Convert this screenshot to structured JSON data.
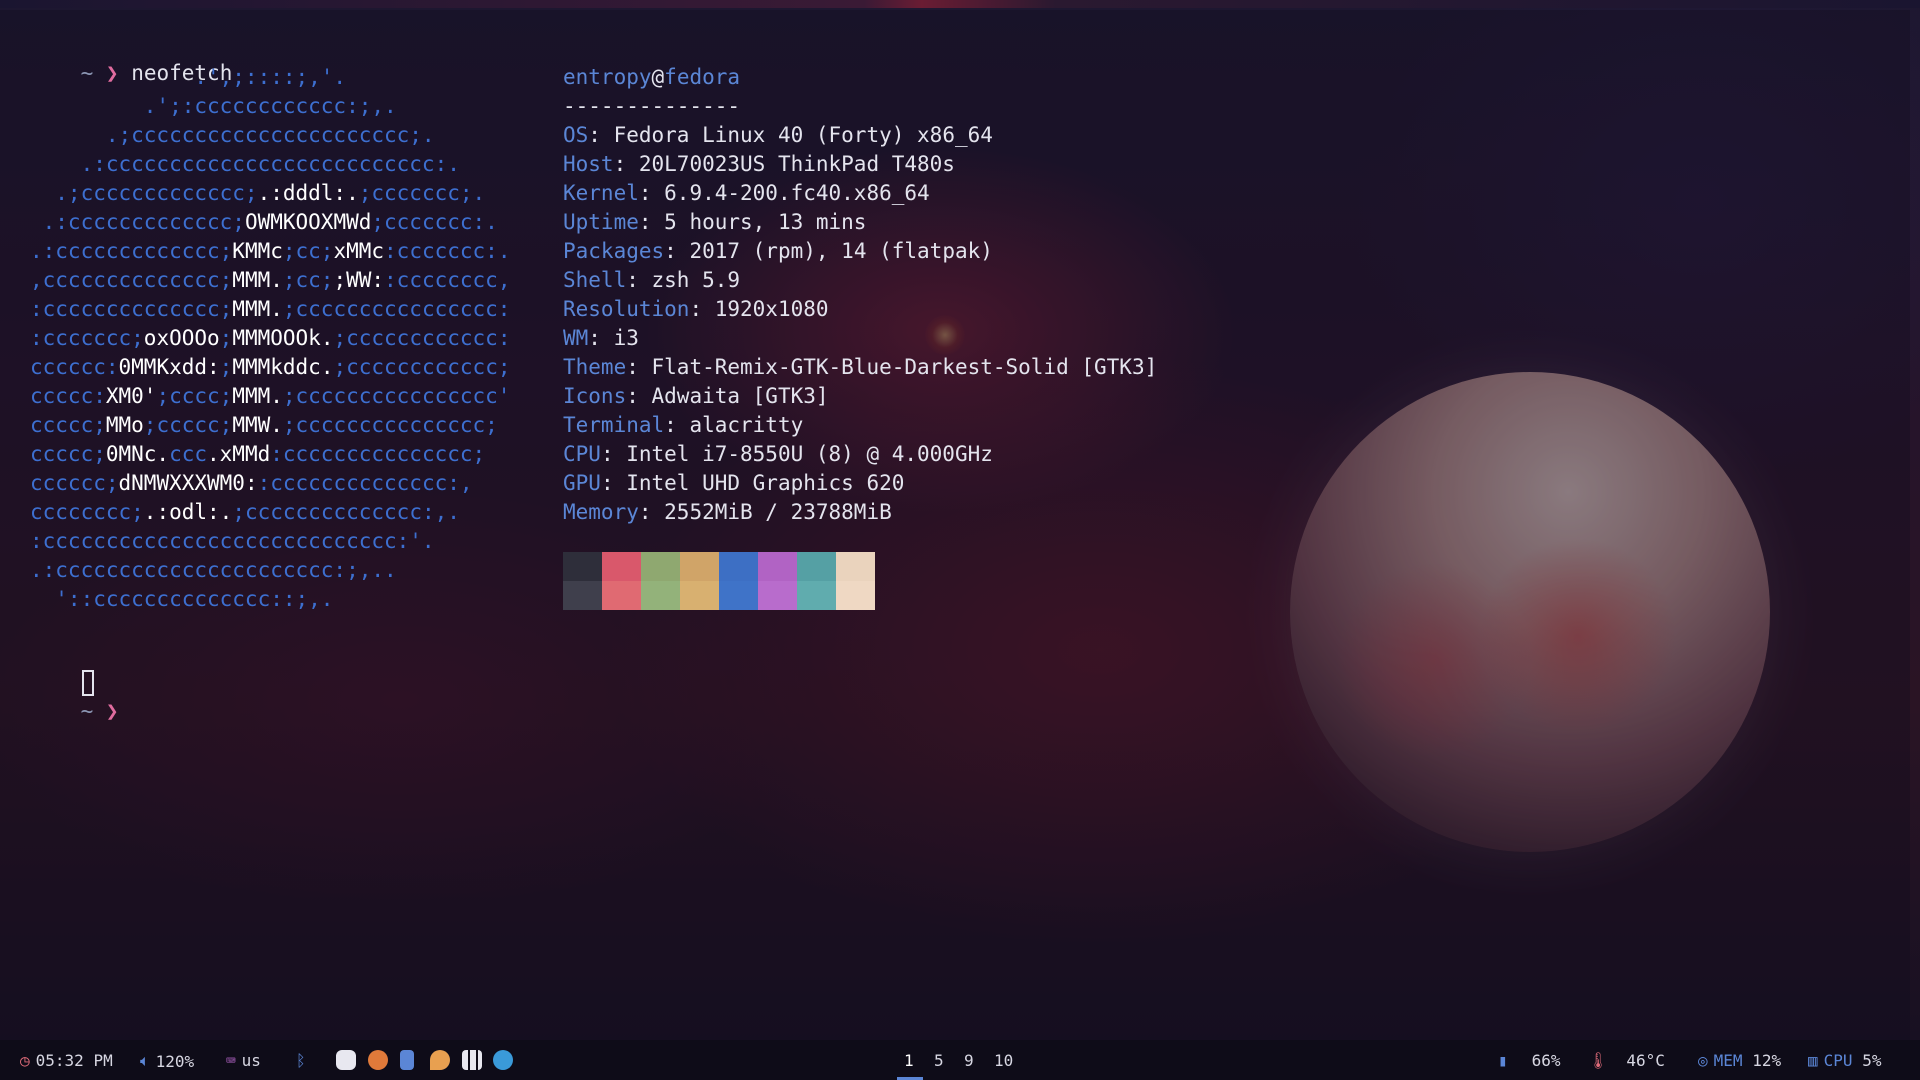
{
  "command_line": {
    "tilde": "~",
    "arrow": "❯",
    "command": "neofetch"
  },
  "ascii_logo": [
    [
      [
        "b",
        "             .',;::::;,'.     "
      ]
    ],
    [
      [
        "b",
        "         .';:cccccccccccc:;,.  "
      ]
    ],
    [
      [
        "b",
        "      .;cccccccccccccccccccccc;."
      ]
    ],
    [
      [
        "b",
        "    .:cccccccccccccccccccccccccc:."
      ]
    ],
    [
      [
        "b",
        "  .;ccccccccccccc;"
      ],
      [
        "w",
        ".:dddl:."
      ],
      [
        "b",
        ";ccccccc;."
      ]
    ],
    [
      [
        "b",
        " .:ccccccccccccc;"
      ],
      [
        "w",
        "OWMKOOXMWd"
      ],
      [
        "b",
        ";ccccccc:."
      ]
    ],
    [
      [
        "b",
        ".:ccccccccccccc;"
      ],
      [
        "w",
        "KMMc"
      ],
      [
        "b",
        ";cc;"
      ],
      [
        "w",
        "xMMc"
      ],
      [
        "b",
        ":ccccccc:."
      ]
    ],
    [
      [
        "b",
        ",cccccccccccccc;"
      ],
      [
        "w",
        "MMM."
      ],
      [
        "b",
        ";cc;"
      ],
      [
        "w",
        ";WW:"
      ],
      [
        "b",
        ":cccccccc,"
      ]
    ],
    [
      [
        "b",
        ":cccccccccccccc;"
      ],
      [
        "w",
        "MMM."
      ],
      [
        "b",
        ";cccccccccccccccc:"
      ]
    ],
    [
      [
        "b",
        ":ccccccc;"
      ],
      [
        "w",
        "oxOOOo"
      ],
      [
        "b",
        ";"
      ],
      [
        "w",
        "MMMOOOk."
      ],
      [
        "b",
        ";cccccccccccc:"
      ]
    ],
    [
      [
        "b",
        "cccccc:"
      ],
      [
        "w",
        "0MMKxdd:"
      ],
      [
        "b",
        ";"
      ],
      [
        "w",
        "MMMkddc."
      ],
      [
        "b",
        ";cccccccccccc;"
      ]
    ],
    [
      [
        "b",
        "ccccc:"
      ],
      [
        "w",
        "XM0'"
      ],
      [
        "b",
        ";cccc;"
      ],
      [
        "w",
        "MMM."
      ],
      [
        "b",
        ";cccccccccccccccc'"
      ]
    ],
    [
      [
        "b",
        "ccccc;"
      ],
      [
        "w",
        "MMo"
      ],
      [
        "b",
        ";ccccc;"
      ],
      [
        "w",
        "MMW."
      ],
      [
        "b",
        ";ccccccccccccccc;"
      ]
    ],
    [
      [
        "b",
        "ccccc;"
      ],
      [
        "w",
        "0MNc."
      ],
      [
        "b",
        "ccc"
      ],
      [
        "w",
        ".xMMd"
      ],
      [
        "b",
        ":ccccccccccccccc;"
      ]
    ],
    [
      [
        "b",
        "cccccc;"
      ],
      [
        "w",
        "dNMWXXXWM0:"
      ],
      [
        "b",
        ":cccccccccccccc:,"
      ]
    ],
    [
      [
        "b",
        "cccccccc;"
      ],
      [
        "w",
        ".:odl:."
      ],
      [
        "b",
        ";cccccccccccccc:,."
      ]
    ],
    [
      [
        "b",
        ":cccccccccccccccccccccccccccc:'."
      ]
    ],
    [
      [
        "b",
        ".:cccccccccccccccccccccc:;,.."
      ]
    ],
    [
      [
        "b",
        "  '::cccccccccccccc::;,."
      ]
    ]
  ],
  "neofetch": {
    "user": "entropy",
    "at": "@",
    "host": "fedora",
    "separator": "--------------",
    "fields": [
      {
        "key": "OS",
        "value": "Fedora Linux 40 (Forty) x86_64"
      },
      {
        "key": "Host",
        "value": "20L70023US ThinkPad T480s"
      },
      {
        "key": "Kernel",
        "value": "6.9.4-200.fc40.x86_64"
      },
      {
        "key": "Uptime",
        "value": "5 hours, 13 mins"
      },
      {
        "key": "Packages",
        "value": "2017 (rpm), 14 (flatpak)"
      },
      {
        "key": "Shell",
        "value": "zsh 5.9"
      },
      {
        "key": "Resolution",
        "value": "1920x1080"
      },
      {
        "key": "WM",
        "value": "i3"
      },
      {
        "key": "Theme",
        "value": "Flat-Remix-GTK-Blue-Darkest-Solid [GTK3]"
      },
      {
        "key": "Icons",
        "value": "Adwaita [GTK3]"
      },
      {
        "key": "Terminal",
        "value": "alacritty"
      },
      {
        "key": "CPU",
        "value": "Intel i7-8550U (8) @ 4.000GHz"
      },
      {
        "key": "GPU",
        "value": "Intel UHD Graphics 620"
      },
      {
        "key": "Memory",
        "value": "2552MiB / 23788MiB"
      }
    ],
    "palette_top": [
      "#2e2e3a",
      "#d9586b",
      "#8fa870",
      "#d0a468",
      "#3d6fc4",
      "#b163c4",
      "#55a0a4",
      "#ead3bd"
    ],
    "palette_bottom": [
      "#3f3f4c",
      "#e06a72",
      "#93b27a",
      "#d8b070",
      "#3f73c8",
      "#b86ccc",
      "#60acae",
      "#efd8c3"
    ]
  },
  "prompt2": {
    "tilde": "~",
    "arrow": "❯"
  },
  "statusbar": {
    "clock": "05:32 PM",
    "volume": "120%",
    "keyboard": "us",
    "workspaces": [
      "1",
      "5",
      "9",
      "10"
    ],
    "active_workspace": "1",
    "battery": "66%",
    "temperature": "46°C",
    "memory_label": "MEM",
    "memory": "12%",
    "cpu_label": "CPU",
    "cpu": "5%",
    "accent": "#5b86d6"
  }
}
